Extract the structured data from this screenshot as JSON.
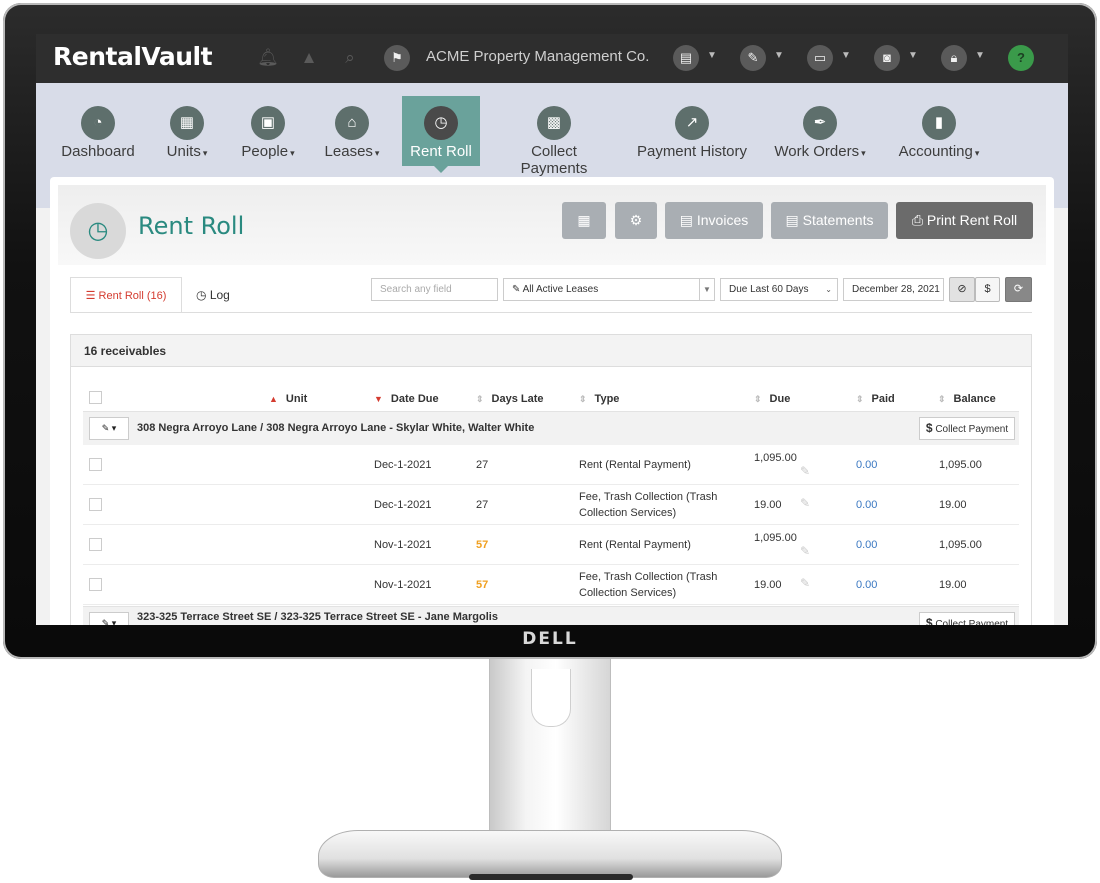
{
  "app": {
    "name": "RentalVault",
    "company": "ACME Property Management Co.",
    "bezel_brand": "DELL"
  },
  "topbar": {
    "icons": [
      "bell-icon",
      "warning-icon",
      "search-icon",
      "flag-icon",
      "document-icon",
      "pen-icon",
      "card-icon",
      "camera-icon",
      "lock-icon",
      "help-icon"
    ]
  },
  "nav": {
    "items": [
      {
        "label": "Dashboard",
        "icon": "gauge-icon",
        "caret": ""
      },
      {
        "label": "Units",
        "icon": "building-icon",
        "caret": "▾"
      },
      {
        "label": "People",
        "icon": "id-card-icon",
        "caret": "▾"
      },
      {
        "label": "Leases",
        "icon": "house-key-icon",
        "caret": "▾"
      },
      {
        "label": "Rent Roll",
        "icon": "clipboard-clock-icon",
        "caret": ""
      },
      {
        "label": "Collect Payments",
        "icon": "calculator-icon",
        "caret": ""
      },
      {
        "label": "Payment History",
        "icon": "chart-icon",
        "caret": ""
      },
      {
        "label": "Work Orders",
        "icon": "wrench-icon",
        "caret": "▾"
      },
      {
        "label": "Accounting",
        "icon": "ledger-icon",
        "caret": "▾"
      }
    ]
  },
  "page": {
    "title": "Rent Roll",
    "buttons": {
      "invoices": "Invoices",
      "statements": "Statements",
      "print": "Print Rent Roll"
    },
    "tabs": {
      "rent_roll": "Rent Roll (16)",
      "log": "Log"
    },
    "filters": {
      "search_placeholder": "Search any field",
      "lease_filter": "All Active Leases",
      "due_filter": "Due Last 60 Days",
      "date": "December 28, 2021",
      "dollar": "$"
    },
    "summary": "16 receivables",
    "columns": {
      "unit": "Unit",
      "date_due": "Date Due",
      "days_late": "Days Late",
      "type": "Type",
      "due": "Due",
      "paid": "Paid",
      "balance": "Balance"
    },
    "collect_label": "Collect Payment",
    "groups": [
      {
        "title": "308 Negra Arroyo Lane / 308 Negra Arroyo Lane - Skylar White, Walter White",
        "rows": [
          {
            "date": "Dec-1-2021",
            "days_late": "27",
            "late": false,
            "type1": "Rent  (Rental Payment)",
            "type2": "",
            "due": "1,095.00",
            "paid": "0.00",
            "balance": "1,095.00"
          },
          {
            "date": "Dec-1-2021",
            "days_late": "27",
            "late": false,
            "type1": "Fee, Trash Collection  (Trash",
            "type2": "Collection Services)",
            "due": "19.00",
            "paid": "0.00",
            "balance": "19.00"
          },
          {
            "date": "Nov-1-2021",
            "days_late": "57",
            "late": true,
            "type1": "Rent  (Rental Payment)",
            "type2": "",
            "due": "1,095.00",
            "paid": "0.00",
            "balance": "1,095.00"
          },
          {
            "date": "Nov-1-2021",
            "days_late": "57",
            "late": true,
            "type1": "Fee, Trash Collection  (Trash",
            "type2": "Collection Services)",
            "due": "19.00",
            "paid": "0.00",
            "balance": "19.00"
          }
        ]
      },
      {
        "title": "323-325 Terrace Street SE / 323-325 Terrace Street SE - Jane Margolis",
        "rows": []
      }
    ]
  }
}
